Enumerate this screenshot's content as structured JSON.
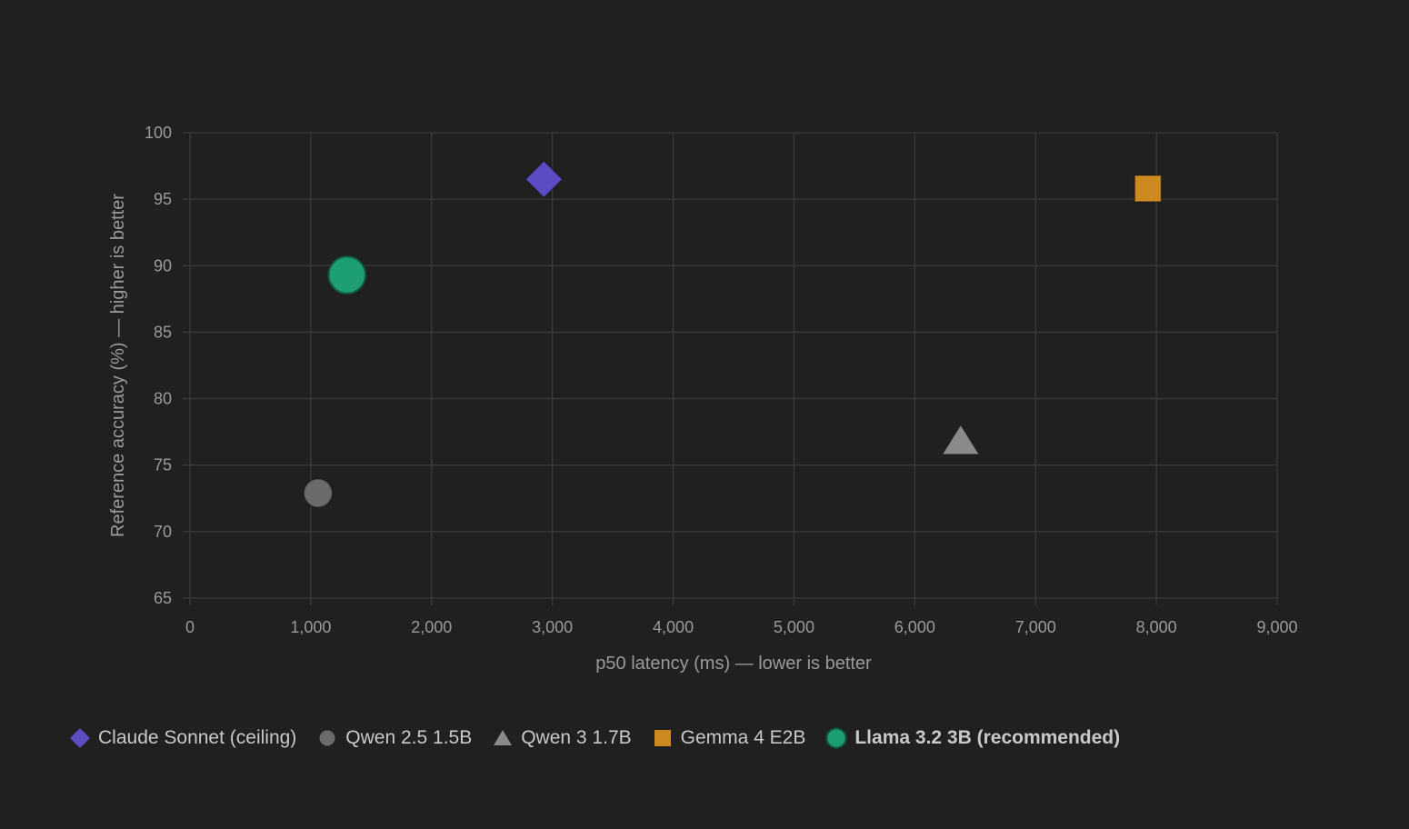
{
  "chart_data": {
    "type": "scatter",
    "xlabel": "p50 latency (ms) — lower is better",
    "ylabel": "Reference accuracy (%) — higher is better",
    "xlim": [
      0,
      9000
    ],
    "ylim": [
      65,
      100
    ],
    "x_ticks": [
      "0",
      "1,000",
      "2,000",
      "3,000",
      "4,000",
      "5,000",
      "6,000",
      "7,000",
      "8,000",
      "9,000"
    ],
    "y_ticks": [
      "65",
      "70",
      "75",
      "80",
      "85",
      "90",
      "95",
      "100"
    ],
    "grid": true,
    "legend_position": "bottom-left",
    "series": [
      {
        "name": "Claude Sonnet (ceiling)",
        "x": 2930,
        "y": 96.5,
        "marker": "diamond",
        "color": "#5b4cc4",
        "emphasis": false
      },
      {
        "name": "Qwen 2.5 1.5B",
        "x": 1060,
        "y": 72.9,
        "marker": "circle",
        "color": "#6b6b6b",
        "emphasis": false
      },
      {
        "name": "Qwen 3 1.7B",
        "x": 6380,
        "y": 76.8,
        "marker": "triangle",
        "color": "#8a8a8a",
        "emphasis": false
      },
      {
        "name": "Gemma 4 E2B",
        "x": 7930,
        "y": 95.8,
        "marker": "square",
        "color": "#cc8a21",
        "emphasis": false
      },
      {
        "name": "Llama 3.2 3B (recommended)",
        "x": 1300,
        "y": 89.3,
        "marker": "circle",
        "color": "#1e9e74",
        "emphasis": true
      }
    ]
  }
}
